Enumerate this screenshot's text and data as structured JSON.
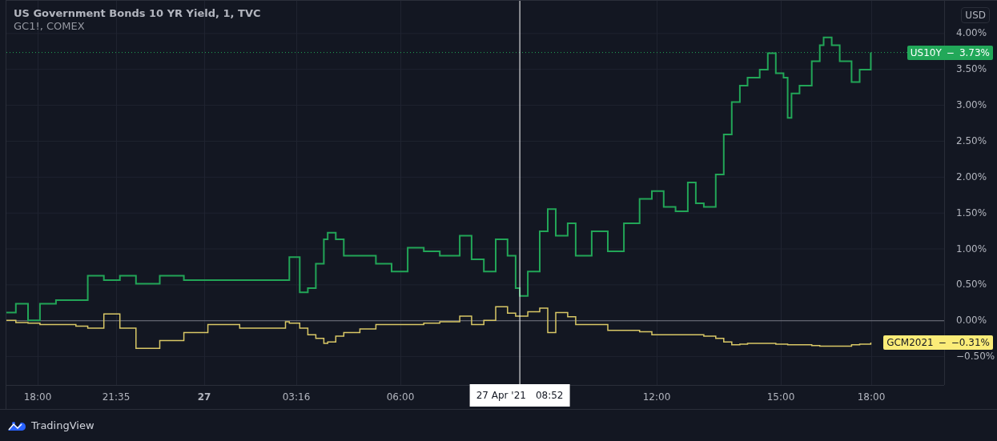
{
  "legend": {
    "title": "US Government Bonds 10 YR Yield, 1, TVC",
    "subtitle": "GC1!, COMEX"
  },
  "currency_button": "USD",
  "chart": {
    "price_scale": [
      "4.00%",
      "3.50%",
      "3.00%",
      "2.50%",
      "2.00%",
      "1.50%",
      "1.00%",
      "0.50%",
      "0.00%",
      "−0.50%"
    ],
    "time_scale": [
      {
        "label": "18:00",
        "bold": false
      },
      {
        "label": "21:35",
        "bold": false
      },
      {
        "label": "27",
        "bold": true
      },
      {
        "label": "03:16",
        "bold": false
      },
      {
        "label": "06:00",
        "bold": false
      },
      {
        "label": "12:00",
        "bold": false
      },
      {
        "label": "15:00",
        "bold": false
      },
      {
        "label": "18:00",
        "bold": false
      }
    ],
    "price_labels": [
      {
        "name": "US10Y",
        "separator": "−",
        "value": "3.73%",
        "color": "#22a859"
      },
      {
        "name": "GCM2021",
        "separator": "−",
        "value": "−0.31%",
        "color": "#fbec78"
      }
    ],
    "crosshair": {
      "date": "27 Apr '21",
      "time": "08:52"
    }
  },
  "footer": {
    "brand": "TradingView"
  }
}
